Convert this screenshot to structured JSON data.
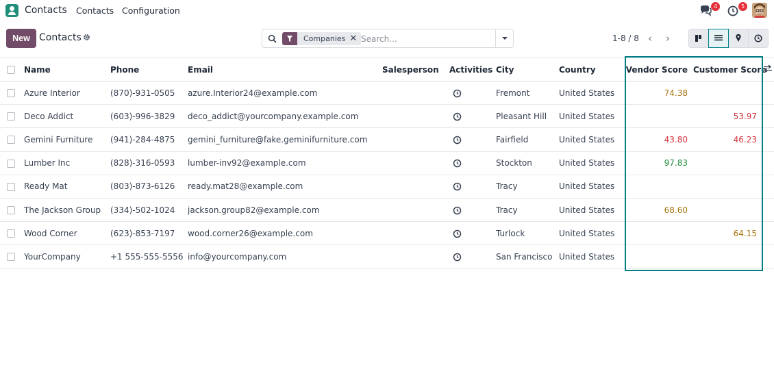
{
  "topbar": {
    "app_name": "Contacts",
    "menu": [
      "Contacts",
      "Configuration"
    ],
    "messages_count": "4",
    "activities_count": "5"
  },
  "control": {
    "new_label": "New",
    "title": "Contacts",
    "filter_facet": "Companies",
    "search_placeholder": "Search...",
    "pager": "1-8 / 8"
  },
  "table": {
    "headers": [
      "Name",
      "Phone",
      "Email",
      "Salesperson",
      "Activities",
      "City",
      "Country",
      "Vendor Score",
      "Customer Score"
    ],
    "rows": [
      {
        "name": "Azure Interior",
        "phone": "(870)-931-0505",
        "email": "azure.Interior24@example.com",
        "salesperson": "",
        "city": "Fremont",
        "country": "United States",
        "vendor": "74.38",
        "vendor_color": "#a8730f",
        "customer": "",
        "customer_color": ""
      },
      {
        "name": "Deco Addict",
        "phone": "(603)-996-3829",
        "email": "deco_addict@yourcompany.example.com",
        "salesperson": "",
        "city": "Pleasant Hill",
        "country": "United States",
        "vendor": "",
        "vendor_color": "",
        "customer": "53.97",
        "customer_color": "#d4343f"
      },
      {
        "name": "Gemini Furniture",
        "phone": "(941)-284-4875",
        "email": "gemini_furniture@fake.geminifurniture.com",
        "salesperson": "",
        "city": "Fairfield",
        "country": "United States",
        "vendor": "43.80",
        "vendor_color": "#d4343f",
        "customer": "46.23",
        "customer_color": "#d4343f"
      },
      {
        "name": "Lumber Inc",
        "phone": "(828)-316-0593",
        "email": "lumber-inv92@example.com",
        "salesperson": "",
        "city": "Stockton",
        "country": "United States",
        "vendor": "97.83",
        "vendor_color": "#218c3a",
        "customer": "",
        "customer_color": ""
      },
      {
        "name": "Ready Mat",
        "phone": "(803)-873-6126",
        "email": "ready.mat28@example.com",
        "salesperson": "",
        "city": "Tracy",
        "country": "United States",
        "vendor": "",
        "vendor_color": "",
        "customer": "",
        "customer_color": ""
      },
      {
        "name": "The Jackson Group",
        "phone": "(334)-502-1024",
        "email": "jackson.group82@example.com",
        "salesperson": "",
        "city": "Tracy",
        "country": "United States",
        "vendor": "68.60",
        "vendor_color": "#a8730f",
        "customer": "",
        "customer_color": ""
      },
      {
        "name": "Wood Corner",
        "phone": "(623)-853-7197",
        "email": "wood.corner26@example.com",
        "salesperson": "",
        "city": "Turlock",
        "country": "United States",
        "vendor": "",
        "vendor_color": "",
        "customer": "64.15",
        "customer_color": "#a8730f"
      },
      {
        "name": "YourCompany",
        "phone": "+1 555-555-5556",
        "email": "info@yourcompany.com",
        "salesperson": "",
        "city": "San Francisco",
        "country": "United States",
        "vendor": "",
        "vendor_color": "",
        "customer": "",
        "customer_color": ""
      }
    ]
  },
  "colors": {
    "brand": "#714b67",
    "accent": "#017e84",
    "badge": "#e5303b"
  }
}
